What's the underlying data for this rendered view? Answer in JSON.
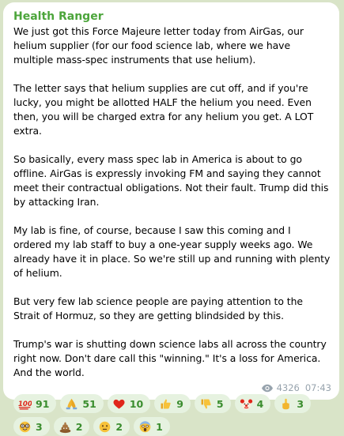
{
  "message": {
    "author": "Health Ranger",
    "paragraphs": [
      "We just got this Force Majeure letter today from AirGas, our helium supplier (for our food science lab, where we have multiple mass-spec instruments that use helium).",
      "The letter says that helium supplies are cut off, and if you're lucky, you might be allotted HALF the helium you need. Even then, you will be charged extra for any helium you get. A LOT extra.",
      "So basically, every mass spec lab in America is about to go offline. AirGas is expressly invoking FM and saying they cannot meet their contractual obligations. Not their fault. Trump did this by attacking Iran.",
      "My lab is fine, of course, because I saw this coming and I ordered my lab staff to buy a one-year supply weeks ago. We already have it in place. So we're still up and running with plenty of helium.",
      "But very few lab science people are paying attention to the Strait of Hormuz, so they are getting blindsided by this.",
      "Trump's war is shutting down science labs all across the country right now. Don't dare call this \"winning.\" It's a loss for America. And the world."
    ],
    "reactions": [
      {
        "icon": "hundred-points-icon",
        "count": "91"
      },
      {
        "icon": "folded-hands-icon",
        "count": "51"
      },
      {
        "icon": "red-heart-icon",
        "count": "10"
      },
      {
        "icon": "thumbs-up-icon",
        "count": "9"
      },
      {
        "icon": "thumbs-down-icon",
        "count": "5"
      },
      {
        "icon": "clown-face-icon",
        "count": "4"
      },
      {
        "icon": "middle-finger-icon",
        "count": "3"
      },
      {
        "icon": "nerd-face-icon",
        "count": "3"
      },
      {
        "icon": "pile-of-poo-icon",
        "count": "2"
      },
      {
        "icon": "neutral-face-icon",
        "count": "2"
      },
      {
        "icon": "screaming-face-icon",
        "count": "1"
      }
    ],
    "views": "4326",
    "time": "07:43"
  },
  "colors": {
    "background": "#d9e4c8",
    "author": "#4ca53b",
    "reaction_bg": "#e6f2e0",
    "reaction_text": "#3a8d2e",
    "meta": "#97a3ad"
  }
}
